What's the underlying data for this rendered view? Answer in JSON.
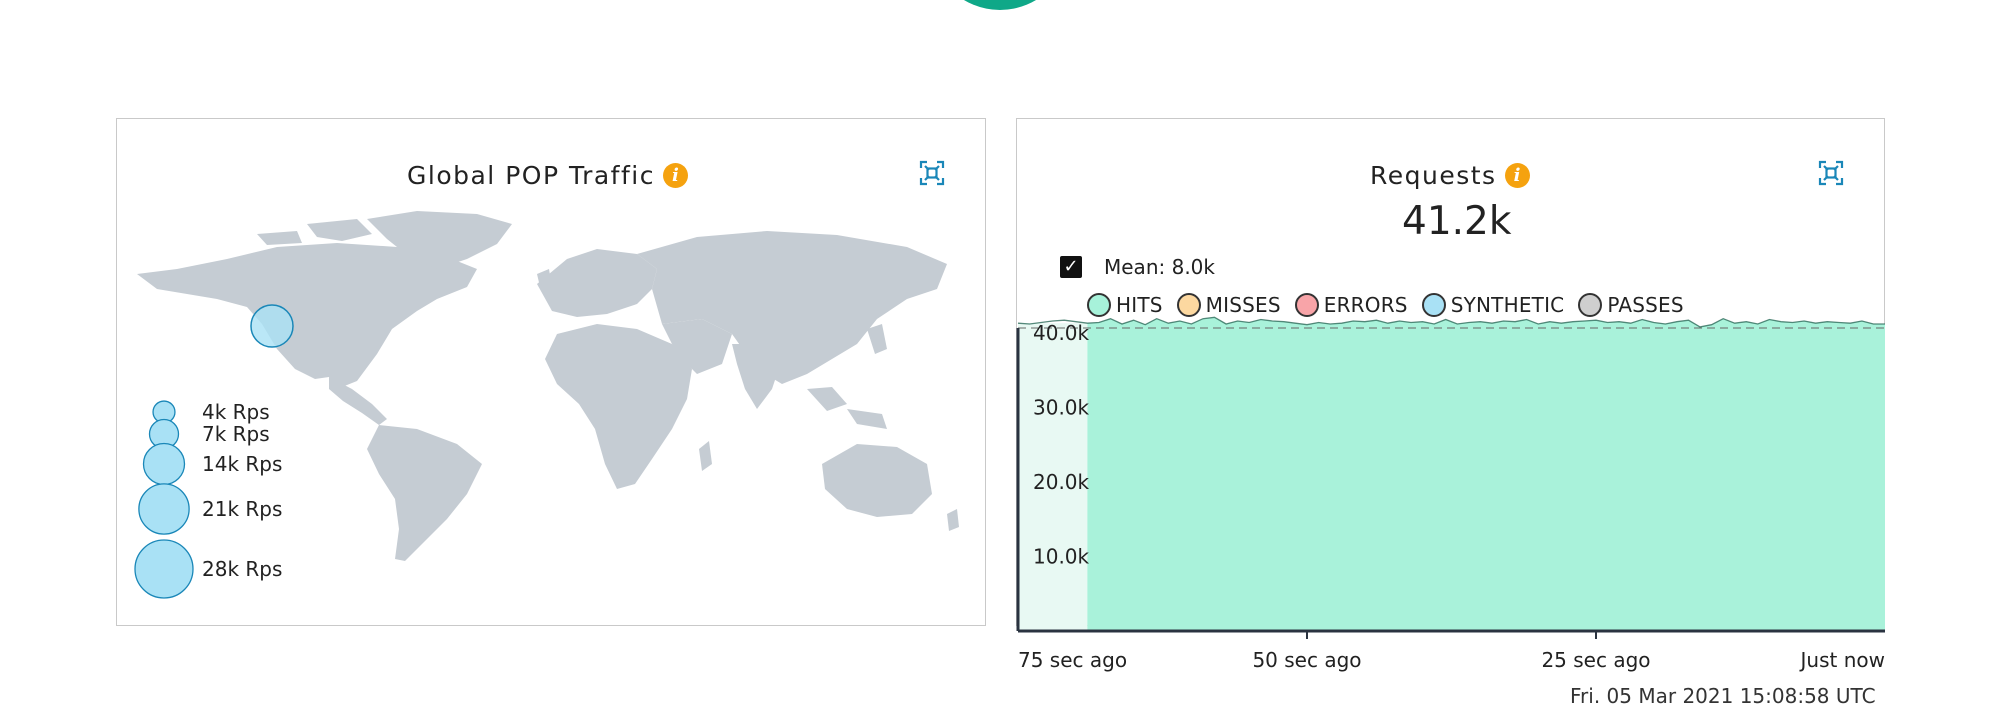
{
  "map_panel": {
    "title": "Global POP Traffic",
    "legend": [
      {
        "label": "4k Rps",
        "value": 4000
      },
      {
        "label": "7k Rps",
        "value": 7000
      },
      {
        "label": "14k Rps",
        "value": 14000
      },
      {
        "label": "21k Rps",
        "value": 21000
      },
      {
        "label": "28k Rps",
        "value": 28000
      }
    ],
    "pop_bubble_rps": 18000
  },
  "requests_panel": {
    "title": "Requests",
    "value": "41.2k",
    "mean_label": "Mean: 8.0k",
    "mean_checked": true,
    "series_legend": [
      {
        "label": "HITS",
        "color": "#a7f2da"
      },
      {
        "label": "MISSES",
        "color": "#fcd8a0"
      },
      {
        "label": "ERRORS",
        "color": "#f8a4a8"
      },
      {
        "label": "SYNTHETIC",
        "color": "#a9e1f5"
      },
      {
        "label": "PASSES",
        "color": "#cfcfcf"
      }
    ],
    "timestamp": "Fri. 05 Mar 2021 15:08:58 UTC"
  },
  "colors": {
    "accent": "#0fa888",
    "info": "#f5a20f",
    "icon": "#1a87b8",
    "hits_fill": "#a9f2da",
    "bubble_fill": "#a9e1f5",
    "land": "#c5ccd3"
  },
  "chart_data": {
    "type": "area",
    "title": "Requests",
    "y_ticks": [
      "10.0k",
      "20.0k",
      "30.0k",
      "40.0k"
    ],
    "x_ticks": [
      "75 sec ago",
      "50 sec ago",
      "25 sec ago",
      "Just now"
    ],
    "ylim": [
      0,
      42000
    ],
    "xlim": [
      -75,
      0
    ],
    "series": [
      {
        "name": "HITS",
        "x": [
          -75,
          -74,
          -73,
          -72,
          -71,
          -70,
          -69,
          -68,
          -67,
          -66,
          -65,
          -64,
          -63,
          -62,
          -61,
          -60,
          -59,
          -58,
          -57,
          -56,
          -55,
          -54,
          -53,
          -52,
          -51,
          -50,
          -49,
          -48,
          -47,
          -46,
          -45,
          -44,
          -43,
          -42,
          -41,
          -40,
          -39,
          -38,
          -37,
          -36,
          -35,
          -34,
          -33,
          -32,
          -31,
          -30,
          -29,
          -28,
          -27,
          -26,
          -25,
          -24,
          -23,
          -22,
          -21,
          -20,
          -19,
          -18,
          -17,
          -16,
          -15,
          -14,
          -13,
          -12,
          -11,
          -10,
          -9,
          -8,
          -7,
          -6,
          -5,
          -4,
          -3,
          -2,
          -1,
          0
        ],
        "values": [
          41300,
          41200,
          41400,
          41600,
          41700,
          41500,
          41300,
          41400,
          41900,
          41200,
          41700,
          41100,
          41900,
          41300,
          41600,
          41200,
          41900,
          42100,
          41200,
          41600,
          41400,
          41800,
          41600,
          41500,
          41300,
          41100,
          41400,
          41200,
          41300,
          41600,
          41500,
          41700,
          41300,
          41600,
          41400,
          41500,
          41200,
          41800,
          41200,
          41400,
          41500,
          41300,
          41600,
          41500,
          41800,
          41200,
          41500,
          41300,
          41500,
          41600,
          41700,
          41400,
          41500,
          41300,
          41800,
          41400,
          41200,
          41500,
          41700,
          40800,
          41100,
          41900,
          41300,
          41500,
          41200,
          41800,
          41500,
          41400,
          41600,
          41300,
          41500,
          41400,
          41300,
          41600,
          41200,
          41200
        ]
      }
    ],
    "mean": 8000,
    "grid": false
  }
}
